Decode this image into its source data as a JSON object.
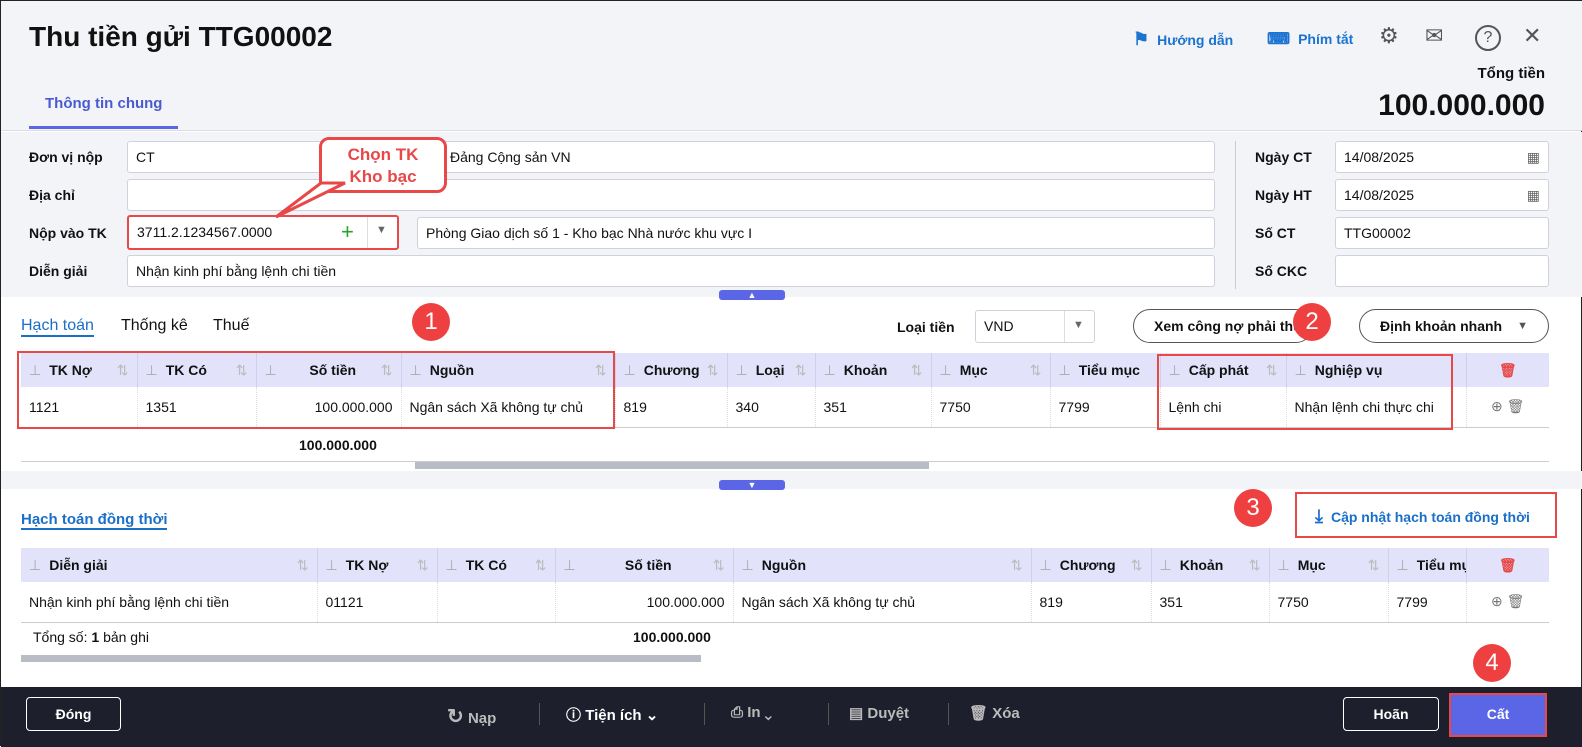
{
  "header": {
    "title": "Thu tiền gửi TTG00002",
    "tab": "Thông tin chung",
    "guide": "Hướng dẫn",
    "shortcuts": "Phím tắt",
    "total_label": "Tổng tiền",
    "total_value": "100.000.000"
  },
  "form": {
    "don_vi_nop_label": "Đơn vị nộp",
    "don_vi_nop_code": "CT",
    "don_vi_nop_name": "Đảng Cộng sản VN",
    "dia_chi_label": "Địa chỉ",
    "dia_chi_value": "",
    "nop_vao_tk_label": "Nộp vào TK",
    "nop_vao_tk_value": "3711.2.1234567.0000",
    "nop_vao_tk_name": "Phòng Giao dịch số 1 - Kho bạc Nhà nước khu vực I",
    "dien_giai_label": "Diễn giải",
    "dien_giai_value": "Nhận kinh phí bằng lệnh chi tiền",
    "ngay_ct_label": "Ngày CT",
    "ngay_ct_value": "14/08/2025",
    "ngay_ht_label": "Ngày HT",
    "ngay_ht_value": "14/08/2025",
    "so_ct_label": "Số CT",
    "so_ct_value": "TTG00002",
    "so_ckc_label": "Số CKC",
    "so_ckc_value": ""
  },
  "callout": {
    "line1": "Chọn TK",
    "line2": "Kho bạc"
  },
  "badges": [
    "1",
    "2",
    "3",
    "4"
  ],
  "detail_tabs": [
    "Hạch toán",
    "Thống kê",
    "Thuế"
  ],
  "currency": {
    "label": "Loại tiền",
    "value": "VND"
  },
  "buttons": {
    "xem_cong_no": "Xem công nợ phải thu",
    "dinh_khoan": "Định khoản nhanh",
    "cap_nhat": "Cập nhật hạch toán đồng thời"
  },
  "table1": {
    "headers": [
      "TK Nợ",
      "TK Có",
      "Số tiền",
      "Nguồn",
      "Chương",
      "Loại",
      "Khoản",
      "Mục",
      "Tiểu mục",
      "Cấp phát",
      "Nghiệp vụ"
    ],
    "rows": [
      [
        "1121",
        "1351",
        "100.000.000",
        "Ngân sách Xã không tự chủ",
        "819",
        "340",
        "351",
        "7750",
        "7799",
        "Lệnh chi",
        "Nhận lệnh chi thực chi"
      ]
    ],
    "total": "100.000.000"
  },
  "section2_title": "Hạch toán đồng thời",
  "table2": {
    "headers": [
      "Diễn giải",
      "TK Nợ",
      "TK Có",
      "Số tiền",
      "Nguồn",
      "Chương",
      "Khoản",
      "Mục",
      "Tiểu mục"
    ],
    "rows": [
      [
        "Nhận kinh phí bằng lệnh chi tiền",
        "01121",
        "",
        "100.000.000",
        "Ngân sách Xã không tự chủ",
        "819",
        "351",
        "7750",
        "7799"
      ]
    ],
    "footer_label": "Tổng số:",
    "footer_count": "1",
    "footer_unit": "bản ghi",
    "total": "100.000.000"
  },
  "footer": {
    "dong": "Đóng",
    "nap": "Nạp",
    "tien_ich": "Tiện ích",
    "in": "In",
    "duyet": "Duyệt",
    "xoa": "Xóa",
    "hoan": "Hoãn",
    "cat": "Cất"
  },
  "colors": {
    "accent": "#5a66e6",
    "highlight": "#e84848"
  }
}
